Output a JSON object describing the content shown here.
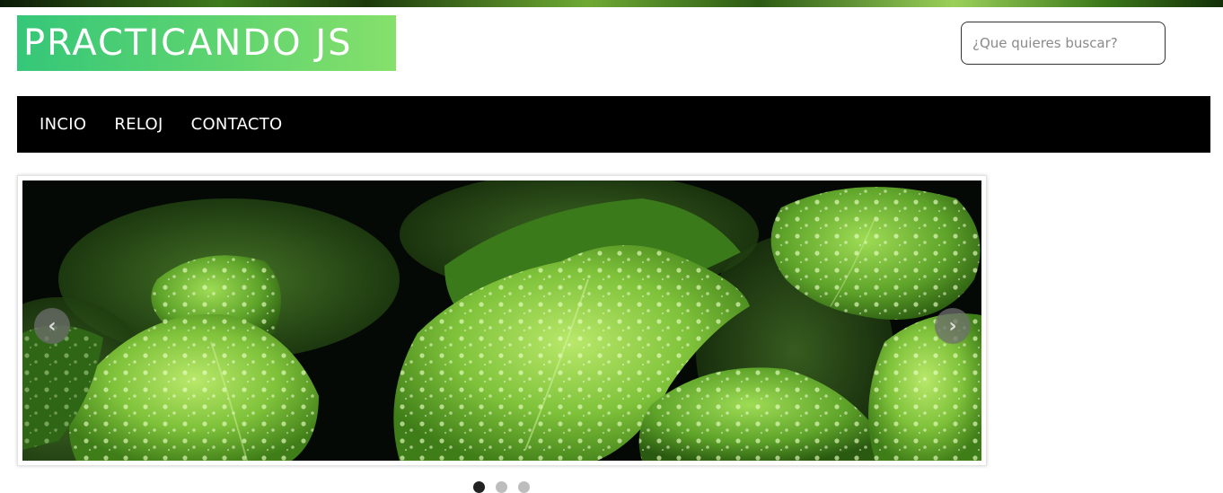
{
  "header": {
    "logo_text": "PRACTICANDO JS"
  },
  "search": {
    "placeholder": "¿Que quieres buscar?"
  },
  "nav": {
    "items": [
      {
        "label": "INCIO"
      },
      {
        "label": "RELOJ"
      },
      {
        "label": "CONTACTO"
      }
    ]
  },
  "slider": {
    "prev_icon": "chevron-left-icon",
    "next_icon": "chevron-right-icon",
    "prev_glyph": "‹",
    "next_glyph": "›",
    "slide_count": 3,
    "active_slide": 1
  },
  "colors": {
    "logo_gradient_start": "#35c779",
    "logo_gradient_end": "#86e06b",
    "nav_background": "#000000",
    "nav_text": "#ffffff"
  }
}
